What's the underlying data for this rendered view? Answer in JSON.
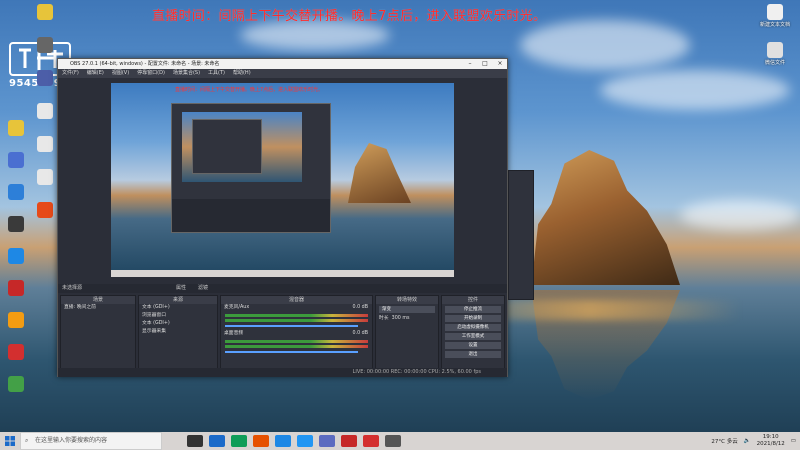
{
  "banner": "直播时间：间隔上下午交替开播。晚上7点后，进入联盟欢乐时光。",
  "logo": {
    "number": "9545379"
  },
  "desktop_icons_left": [
    {
      "label": "",
      "color": "#e7c43a"
    },
    {
      "label": "",
      "color": "#4a6fd1"
    },
    {
      "label": "",
      "color": "#2d7fd8"
    },
    {
      "label": "",
      "color": "#3a3a3a"
    },
    {
      "label": "",
      "color": "#1e88e5"
    },
    {
      "label": "",
      "color": "#c62828"
    },
    {
      "label": "",
      "color": "#f39c12"
    },
    {
      "label": "",
      "color": "#d32f2f"
    },
    {
      "label": "",
      "color": "#43a047"
    }
  ],
  "desktop_icons_left2": [
    {
      "label": "",
      "color": "#e7c43a"
    },
    {
      "label": "",
      "color": "#666"
    },
    {
      "label": "",
      "color": "#4c5ea8"
    },
    {
      "label": "",
      "color": "#e8e8e8"
    },
    {
      "label": "",
      "color": "#e8e8e8"
    },
    {
      "label": "",
      "color": "#e8e8e8"
    },
    {
      "label": "",
      "color": "#e64a19"
    }
  ],
  "desktop_icons_right": [
    {
      "label": "新建文本文档",
      "color": "#f0f0f0"
    },
    {
      "label": "微信文件",
      "color": "#e0e0e0"
    }
  ],
  "obs": {
    "title": "OBS 27.0.1 (64-bit, windows) - 配置文件: 未命名 - 场景: 未命名",
    "menu": [
      "文件(F)",
      "编辑(E)",
      "视图(V)",
      "停靠窗口(D)",
      "场景集合(S)",
      "工具(T)",
      "帮助(H)"
    ],
    "status_row": "未选择源",
    "status_buttons": [
      "属性",
      "滤镜"
    ],
    "docks": {
      "scenes": {
        "title": "场景",
        "items": [
          "直播: 晚间之前"
        ]
      },
      "sources": {
        "title": "来源",
        "items": [
          "文本 (GDI+)",
          "浏览器窗口",
          "文本 (GDI+)",
          "显示器采集"
        ]
      },
      "mixer": {
        "title": "混音器",
        "channels": [
          {
            "name": "麦克风/Aux",
            "db": "0.0 dB"
          },
          {
            "name": "桌面音频",
            "db": "0.0 dB"
          }
        ]
      },
      "transitions": {
        "title": "转场特效",
        "type": "渐变",
        "duration_label": "时长",
        "duration": "300 ms"
      },
      "controls": {
        "title": "控件",
        "buttons": [
          "停止推流",
          "开始录制",
          "启动虚拟摄像机",
          "工作室模式",
          "设置",
          "退出"
        ]
      }
    },
    "footer": "LIVE: 00:00:00   REC: 00:00:00   CPU: 2.5%, 60.00 fps"
  },
  "taskbar": {
    "search_placeholder": "在这里输入你要搜索的内容",
    "weather": "27°C 多云",
    "time": "19:10",
    "date": "2021/8/12"
  }
}
